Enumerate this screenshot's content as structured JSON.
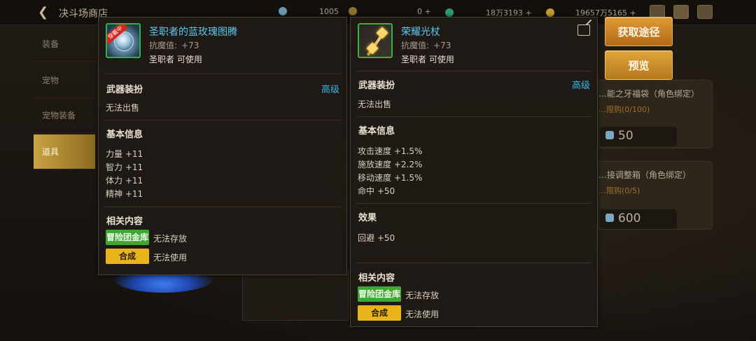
{
  "topbar": {
    "title": "决斗场商店",
    "resources": [
      {
        "value": "1005",
        "icon": "dueling-coin-icon"
      },
      {
        "value": "0 +",
        "icon": "gold-coin-icon"
      },
      {
        "value": "18万3193 +",
        "icon": "green-gem-icon"
      },
      {
        "value": "19657万5165 +",
        "icon": "gold-ingot-icon"
      }
    ]
  },
  "sidebar": {
    "items": [
      {
        "label": "装备"
      },
      {
        "label": "宠物"
      },
      {
        "label": "宠物装备"
      },
      {
        "label": "道具"
      }
    ]
  },
  "bg_cards": [
    {
      "name": "…能之牙福袋（角色绑定）",
      "limit": "…限购(0/100)",
      "price": "50"
    },
    {
      "name": "…接调整箱（角色绑定）",
      "limit": "…限购(0/5)",
      "price": "600"
    }
  ],
  "left_item": {
    "name": "圣职者的蓝玫瑰图腾",
    "wearing_tag": "穿戴中",
    "stat_label": "抗魔值:",
    "stat_value": "+73",
    "class_text": "圣职者 可使用",
    "weapon_skin": "武器装扮",
    "grade": "高级",
    "sell": "无法出售",
    "basic_info": "基本信息",
    "stats": [
      "力量 +11",
      "智力 +11",
      "体力 +11",
      "精神 +11"
    ],
    "related": "相关内容",
    "guild_bank": "冒险团金库",
    "guild_bank_desc": "无法存放",
    "synth": "合成",
    "synth_desc": "无法使用"
  },
  "right_item": {
    "name": "荣耀光杖",
    "stat_label": "抗魔值:",
    "stat_value": "+73",
    "class_text": "圣职者 可使用",
    "weapon_skin": "武器装扮",
    "grade": "高级",
    "sell": "无法出售",
    "basic_info": "基本信息",
    "stats": [
      "攻击速度 +1.5%",
      "施放速度 +2.2%",
      "移动速度 +1.5%",
      "命中 +50"
    ],
    "effect_head": "效果",
    "effect": "回避 +50",
    "related": "相关内容",
    "guild_bank": "冒险团金库",
    "guild_bank_desc": "无法存放",
    "synth": "合成",
    "synth_desc": "无法使用"
  },
  "buttons": {
    "source": "获取途径",
    "preview": "预览"
  },
  "colors": {
    "item_name": "#5ec9f0",
    "grade": "#3fb6e8",
    "green_badge": "#3fa634",
    "yellow_badge": "#e8b41a",
    "action_button": "#d08a2a"
  }
}
